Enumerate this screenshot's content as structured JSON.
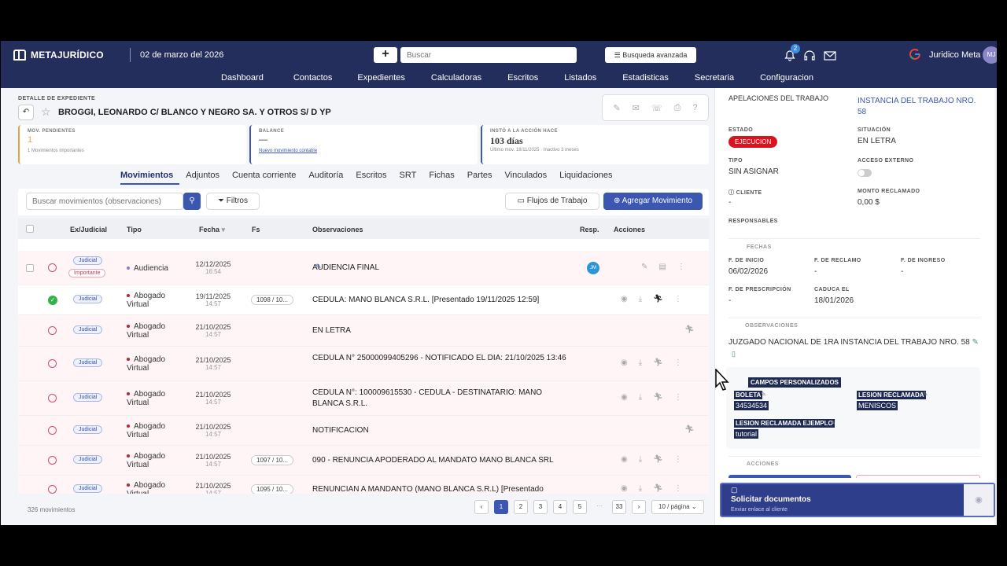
{
  "header": {
    "brand": "METAJURÍDICO",
    "date": "02 de marzo del 2026",
    "search_placeholder": "Buscar",
    "advanced_search": "Busqueda avanzada",
    "notif_count": "2",
    "user_name": "Juridico Meta",
    "user_initials": "MJ"
  },
  "nav": [
    "Dashboard",
    "Contactos",
    "Expedientes",
    "Calculadoras",
    "Escritos",
    "Listados",
    "Estadisticas",
    "Secretaria",
    "Configuracion"
  ],
  "expediente": {
    "crumb": "DETALLE DE EXPEDIENTE",
    "title": "BROGGI, LEONARDO C/ BLANCO Y NEGRO SA. Y OTROS S/ D YP"
  },
  "cards": [
    {
      "label": "MOV. PENDIENTES",
      "value": "1",
      "sub": "1 Movimientos importantes"
    },
    {
      "label": "BALANCE",
      "value": "—",
      "sub": "Nuevo movimiento contable"
    },
    {
      "label": "INSTÓ A LA ACCIÓN HACE",
      "value": "103 días",
      "sub": "Último mov. 18/11/2025 · Inactivo 3 meses"
    }
  ],
  "tabs": [
    "Movimientos",
    "Adjuntos",
    "Cuenta corriente",
    "Auditoría",
    "Escritos",
    "SRT",
    "Fichas",
    "Partes",
    "Vinculados",
    "Liquidaciones"
  ],
  "toolbar": {
    "search_placeholder": "Buscar movimientos (observaciones)",
    "filters": "Filtros",
    "flows": "Flujos de Trabajo",
    "add": "Agregar Movimiento"
  },
  "table": {
    "columns": [
      "Ex/Judicial",
      "Tipo",
      "Fecha",
      "Fs",
      "Observaciones",
      "Resp.",
      "Acciones"
    ],
    "rows": [
      {
        "status": "clock",
        "tag": "Judicial",
        "tag2": "Importante",
        "tipo": "Audiencia",
        "date": "12/12/2025",
        "time": "16:54",
        "fs": "",
        "obs": "AUDIENCIA FINAL",
        "resp": "JM",
        "pink": true
      },
      {
        "status": "check",
        "tag": "Judicial",
        "tipo": "Abogado Virtual",
        "date": "19/11/2025",
        "time": "14:57",
        "fs": "1098 / 10...",
        "obs": "CEDULA: MANO BLANCA S.R.L. [Presentado 19/11/2025 12:59]",
        "pink": false
      },
      {
        "status": "clock",
        "tag": "Judicial",
        "tipo": "Abogado Virtual",
        "date": "21/10/2025",
        "time": "14:57",
        "fs": "",
        "obs": "EN LETRA",
        "pink": true
      },
      {
        "status": "clock",
        "tag": "Judicial",
        "tipo": "Abogado Virtual",
        "date": "21/10/2025",
        "time": "14:57",
        "fs": "",
        "obs": "CEDULA N° 25000099405296 - NOTIFICADO EL DIA: 21/10/2025 13:46",
        "pink": true
      },
      {
        "status": "clock",
        "tag": "Judicial",
        "tipo": "Abogado Virtual",
        "date": "21/10/2025",
        "time": "14:57",
        "fs": "",
        "obs": "CEDULA N°: 100009615530 - CEDULA - DESTINATARIO: MANO BLANCA S.R.L.",
        "pink": true
      },
      {
        "status": "clock",
        "tag": "Judicial",
        "tipo": "Abogado Virtual",
        "date": "21/10/2025",
        "time": "14:57",
        "fs": "",
        "obs": "NOTIFICACION",
        "pink": true
      },
      {
        "status": "clock",
        "tag": "Judicial",
        "tipo": "Abogado Virtual",
        "date": "21/10/2025",
        "time": "14:57",
        "fs": "1097 / 10...",
        "obs": "090 - RENUNCIA APODERADO AL MANDATO MANO BLANCA SRL",
        "pink": true
      },
      {
        "status": "clock",
        "tag": "Judicial",
        "tipo": "Abogado Virtual",
        "date": "21/10/2025",
        "time": "14:57",
        "fs": "1095 / 10...",
        "obs": "RENUNCIAN A MANDANTO (MANO BLANCA S.R.L) [Presentado",
        "pink": true
      }
    ]
  },
  "pagination": {
    "total": "326 movimientos",
    "pages": [
      "1",
      "2",
      "3",
      "4",
      "5",
      "···",
      "33"
    ],
    "per_page": "10 / página"
  },
  "detail": {
    "apel": "APELACIONES DEL TRABAJO",
    "instancia": "INSTANCIA DEL TRABAJO NRO. 58",
    "estado_label": "ESTADO",
    "estado": "EJECUCION",
    "situacion_label": "SITUACIÓN",
    "situacion": "EN LETRA",
    "tipo_label": "TIPO",
    "tipo": "SIN ASIGNAR",
    "acceso_label": "ACCESO EXTERNO",
    "cliente_label": "CLIENTE",
    "cliente": "-",
    "monto_label": "MONTO RECLAMADO",
    "monto": "0,00 $",
    "responsables_label": "RESPONSABLES",
    "fechas_label": "FECHAS",
    "f_inicio_label": "F. DE INICIO",
    "f_inicio": "06/02/2026",
    "f_reclamo_label": "F. DE RECLAMO",
    "f_reclamo": "-",
    "f_ingreso_label": "F. DE INGRESO",
    "f_ingreso": "-",
    "f_prescripcion_label": "F. DE PRESCRIPCIÓN",
    "f_prescripcion": "-",
    "caduca_label": "CADUCA EL",
    "caduca": "18/01/2026",
    "obs_label": "OBSERVACIONES",
    "obs": "JUZGADO NACIONAL DE 1RA INSTANCIA DEL TRABAJO NRO. 58",
    "campos_label": "CAMPOS PERSONALIZADOS",
    "boleta_label": "BOLETA",
    "boleta": "34534534",
    "lesion_label": "LESION RECLAMADA",
    "lesion": "MENISCOS",
    "lesion_ej_label": "LESION RECLAMADA EJEMPLO",
    "lesion_ej": "tutorial",
    "acciones_label": "ACCIONES",
    "solicitar": "Solicitar documentos",
    "solicitar_sub": "Enviar enlace al cliente"
  },
  "colors": {
    "navy": "#242e5c",
    "primary": "#3b57b0",
    "danger": "#d9141f",
    "success": "#32b24a"
  }
}
